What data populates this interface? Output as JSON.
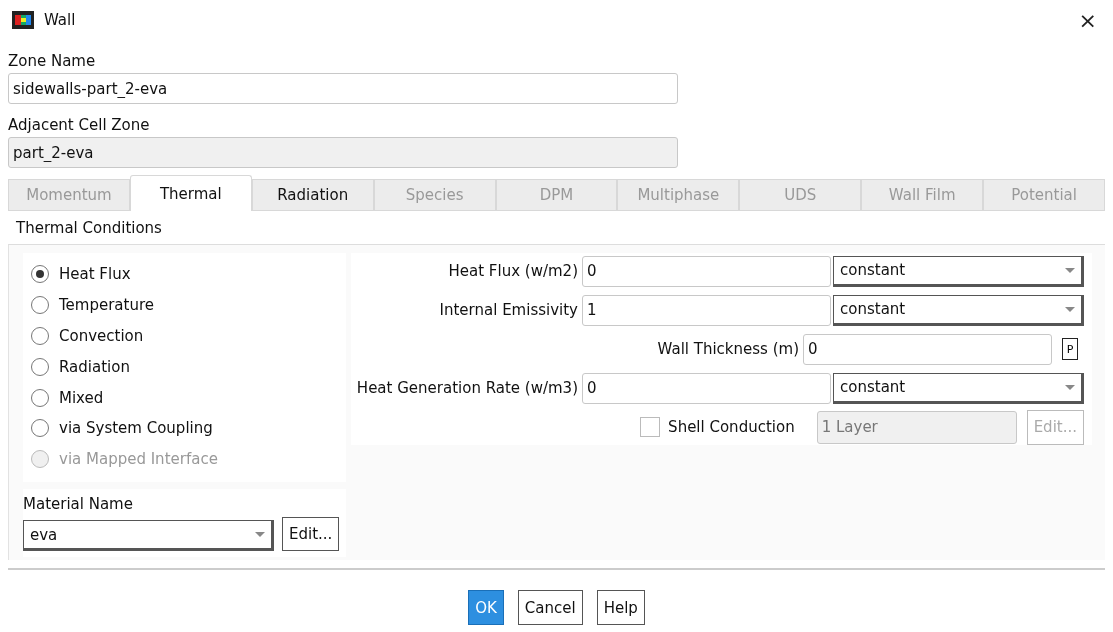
{
  "window": {
    "title": "Wall",
    "close": "×"
  },
  "zone_name": {
    "label": "Zone Name",
    "value": "sidewalls-part_2-eva"
  },
  "adjacent_cell_zone": {
    "label": "Adjacent Cell Zone",
    "value": "part_2-eva",
    "disabled": true
  },
  "tabs": [
    {
      "label": "Momentum",
      "selected": false,
      "disabled": true
    },
    {
      "label": "Thermal",
      "selected": true,
      "disabled": false
    },
    {
      "label": "Radiation",
      "selected": false,
      "disabled": false
    },
    {
      "label": "Species",
      "selected": false,
      "disabled": true
    },
    {
      "label": "DPM",
      "selected": false,
      "disabled": true
    },
    {
      "label": "Multiphase",
      "selected": false,
      "disabled": true
    },
    {
      "label": "UDS",
      "selected": false,
      "disabled": true
    },
    {
      "label": "Wall Film",
      "selected": false,
      "disabled": true
    },
    {
      "label": "Potential",
      "selected": false,
      "disabled": true
    }
  ],
  "thermal_conditions": {
    "label": "Thermal Conditions",
    "options": [
      {
        "label": "Heat Flux",
        "selected": true,
        "disabled": false
      },
      {
        "label": "Temperature",
        "selected": false,
        "disabled": false
      },
      {
        "label": "Convection",
        "selected": false,
        "disabled": false
      },
      {
        "label": "Radiation",
        "selected": false,
        "disabled": false
      },
      {
        "label": "Mixed",
        "selected": false,
        "disabled": false
      },
      {
        "label": "via System Coupling",
        "selected": false,
        "disabled": false
      },
      {
        "label": "via Mapped Interface",
        "selected": false,
        "disabled": true
      }
    ],
    "material": {
      "label": "Material Name",
      "value": "eva",
      "button": "Edit..."
    },
    "rows": [
      {
        "kind": "value_method",
        "label": "Heat Flux (w/m2)",
        "value": "0",
        "method": "constant"
      },
      {
        "kind": "value_method",
        "label": "Internal Emissivity",
        "value": "1",
        "method": "constant"
      },
      {
        "kind": "value_param",
        "label": "Wall Thickness (m)",
        "value": "0",
        "param": "P"
      },
      {
        "kind": "value_method",
        "label": "Heat Generation Rate (w/m3)",
        "value": "0",
        "method": "constant"
      },
      {
        "kind": "checkbox",
        "label": "Shell Conduction",
        "checked": false,
        "value": "1 Layer",
        "button": "Edit...",
        "disabled": true
      }
    ]
  },
  "buttons": [
    {
      "label": "OK",
      "default": true
    },
    {
      "label": "Cancel",
      "default": false
    },
    {
      "label": "Help",
      "default": false
    }
  ]
}
